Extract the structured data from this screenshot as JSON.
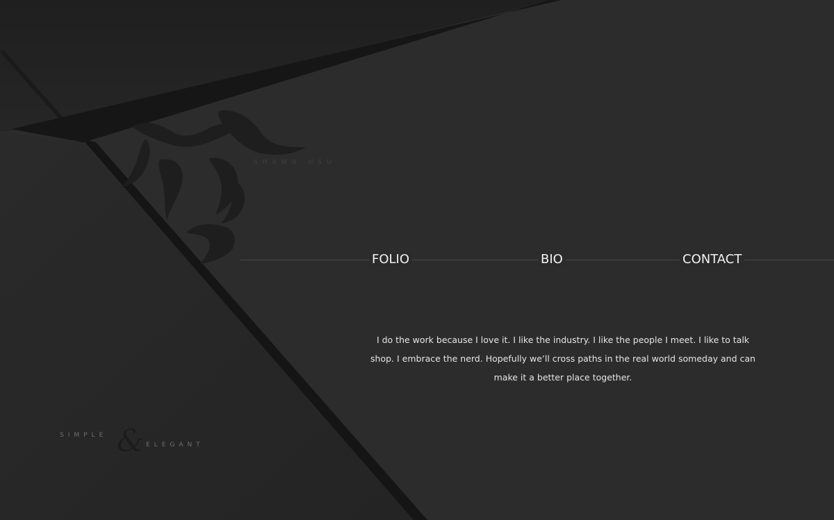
{
  "brand": {
    "name": "SHAWN HSU",
    "logo_glyph": "吳"
  },
  "nav": {
    "items": [
      {
        "label": "FOLIO"
      },
      {
        "label": "BIO"
      },
      {
        "label": "CONTACT"
      }
    ]
  },
  "intro": {
    "text": "I do the work because I love it. I like the industry. I like the people I meet. I like to talk shop. I embrace the nerd. Hopefully we’ll cross paths in the real world someday and can make it a better place together."
  },
  "tagline": {
    "word1": "SIMPLE",
    "ampersand": "&",
    "word2": "ELEGANT"
  },
  "colors": {
    "background": "#2b2b2b",
    "text": "#e6e6e6",
    "nav_text": "#f2f2f2",
    "shadow": "#141414"
  }
}
